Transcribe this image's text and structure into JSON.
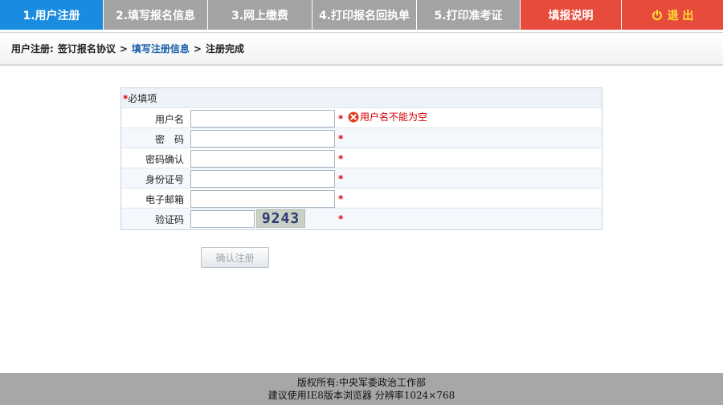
{
  "nav": {
    "steps": [
      {
        "label": "1.用户注册"
      },
      {
        "label": "2.填写报名信息"
      },
      {
        "label": "3.网上缴费"
      },
      {
        "label": "4.打印报名回执单"
      },
      {
        "label": "5.打印准考证"
      },
      {
        "label": "填报说明"
      },
      {
        "label": "退 出"
      }
    ],
    "colors": {
      "active": "#1a8ce0",
      "inactive": "#a3a3a3",
      "action": "#e64b3c",
      "logout_text": "#ffe033"
    }
  },
  "breadcrumb": {
    "root": "用户注册:",
    "items": [
      "签订报名协议",
      "填写注册信息",
      "注册完成"
    ],
    "separator": ">"
  },
  "form": {
    "required_mark": "*",
    "required_note": "必填项",
    "fields": [
      {
        "label": "用户名",
        "value": "",
        "error": "用户名不能为空"
      },
      {
        "label": "密　码",
        "value": ""
      },
      {
        "label": "密码确认",
        "value": ""
      },
      {
        "label": "身份证号",
        "value": ""
      },
      {
        "label": "电子邮箱",
        "value": ""
      },
      {
        "label": "验证码",
        "value": "",
        "captcha": "9243"
      }
    ],
    "submit_label": "确认注册"
  },
  "footer": {
    "line1": "版权所有:中央军委政治工作部",
    "line2": "建议使用IE8版本浏览器 分辨率1024×768"
  }
}
